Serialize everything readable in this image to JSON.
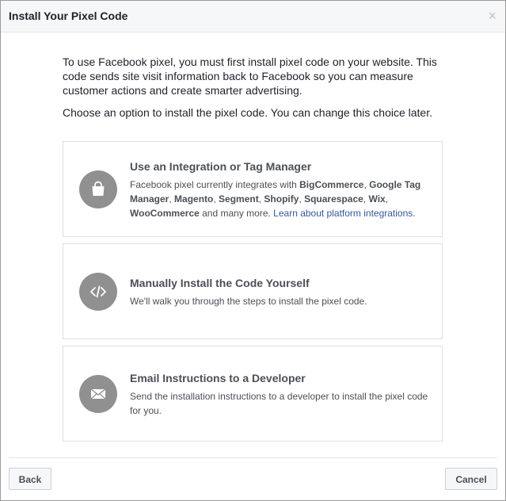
{
  "dialog": {
    "title": "Install Your Pixel Code",
    "close_glyph": "×"
  },
  "intro": {
    "paragraph1": "To use Facebook pixel, you must first install pixel code on your website. This code sends site visit information back to Facebook so you can measure customer actions and create smarter advertising.",
    "paragraph2": "Choose an option to install the pixel code. You can change this choice later."
  },
  "options": [
    {
      "title": "Use an Integration or Tag Manager",
      "icon": "shopping-bag-icon",
      "desc_prefix": "Facebook pixel currently integrates with ",
      "integrations": [
        "BigCommerce",
        "Google Tag Manager",
        "Magento",
        "Segment",
        "Shopify",
        "Squarespace",
        "Wix",
        "WooCommerce"
      ],
      "desc_suffix": " and many more. ",
      "link": "Learn about platform integrations."
    },
    {
      "title": "Manually Install the Code Yourself",
      "icon": "code-icon",
      "desc": "We'll walk you through the steps to install the pixel code."
    },
    {
      "title": "Email Instructions to a Developer",
      "icon": "envelope-icon",
      "desc": "Send the installation instructions to a developer to install the pixel code for you."
    }
  ],
  "footer": {
    "back_label": "Back",
    "cancel_label": "Cancel"
  },
  "colors": {
    "icon_circle": "#909090",
    "link": "#365899",
    "border": "#dddfe2"
  }
}
